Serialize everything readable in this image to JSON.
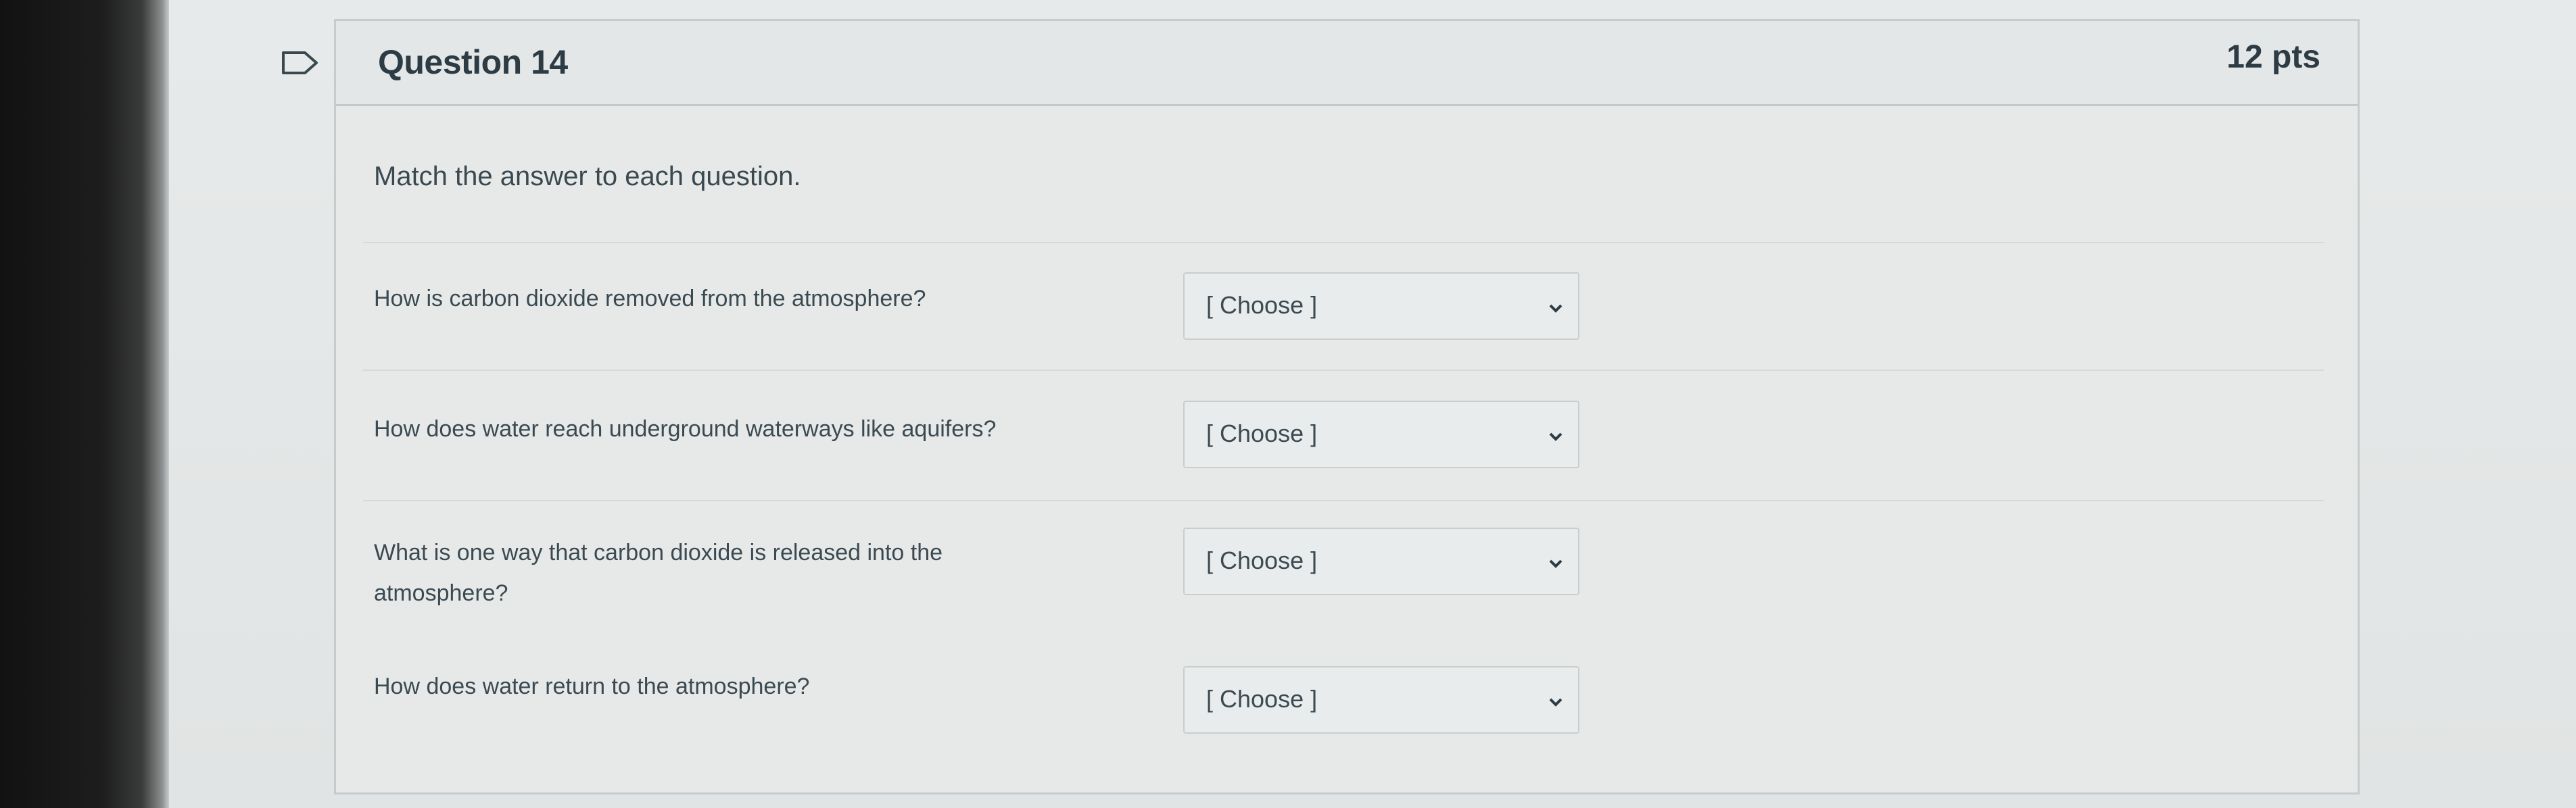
{
  "question": {
    "title": "Question 14",
    "points": "12 pts",
    "instruction": "Match the answer to each question."
  },
  "rows": [
    {
      "prompt": "How is carbon dioxide removed from the atmosphere?",
      "selected": "[ Choose ]"
    },
    {
      "prompt": "How does water reach underground waterways like aquifers?",
      "selected": "[ Choose ]"
    },
    {
      "prompt": "What is one way that carbon dioxide is released into the atmosphere?",
      "selected": "[ Choose ]"
    },
    {
      "prompt": "How does water return to the atmosphere?",
      "selected": "[ Choose ]"
    }
  ],
  "icons": {
    "flag": "flag-icon",
    "chevron": "chevron-down-icon"
  },
  "colors": {
    "text": "#2d3b45",
    "border": "#c6cbcb",
    "background": "#e6e9e8"
  }
}
